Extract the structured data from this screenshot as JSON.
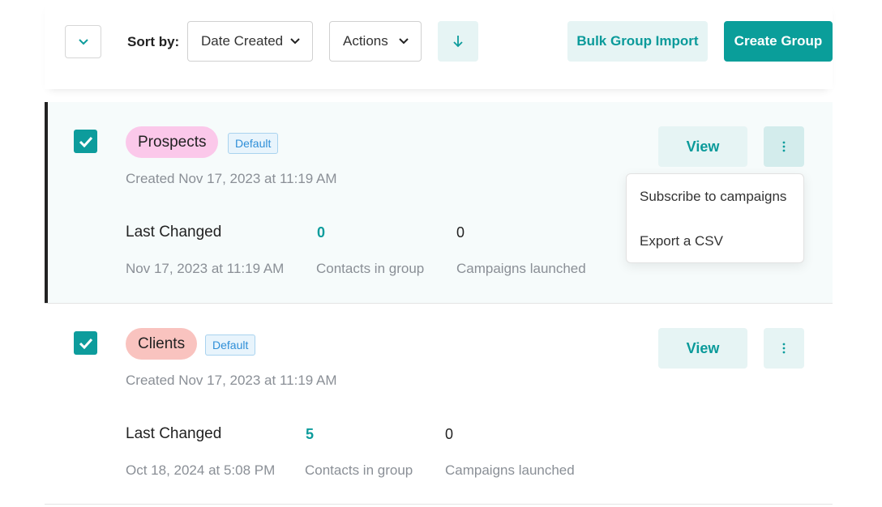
{
  "toolbar": {
    "sort_label": "Sort by:",
    "sort_value": "Date Created",
    "actions_label": "Actions",
    "bulk_import_label": "Bulk Group Import",
    "create_group_label": "Create Group"
  },
  "groups": [
    {
      "name": "Prospects",
      "badge": "Default",
      "created": "Created Nov 17, 2023 at 11:19 AM",
      "last_changed_label": "Last Changed",
      "last_changed_value": "Nov 17, 2023 at 11:19 AM",
      "contacts_count": "0",
      "contacts_label": "Contacts in group",
      "campaigns_count": "0",
      "campaigns_label": "Campaigns launched",
      "view_label": "View",
      "pill_color": "#fbc8ea"
    },
    {
      "name": "Clients",
      "badge": "Default",
      "created": "Created Nov 17, 2023 at 11:19 AM",
      "last_changed_label": "Last Changed",
      "last_changed_value": "Oct 18, 2024 at 5:08 PM",
      "contacts_count": "5",
      "contacts_label": "Contacts in group",
      "campaigns_count": "0",
      "campaigns_label": "Campaigns launched",
      "view_label": "View",
      "pill_color": "#f9c3bf"
    }
  ],
  "dropdown": {
    "items": [
      "Subscribe to campaigns",
      "Export a CSV"
    ]
  },
  "colors": {
    "accent": "#0d9c9c",
    "accent_light": "#e6f4f4",
    "badge_text": "#2f8fd8"
  },
  "icons": {
    "collapse": "chevron-down-icon",
    "sort_direction": "arrow-down-icon",
    "more": "vertical-dots-icon",
    "checkbox": "check-icon"
  }
}
